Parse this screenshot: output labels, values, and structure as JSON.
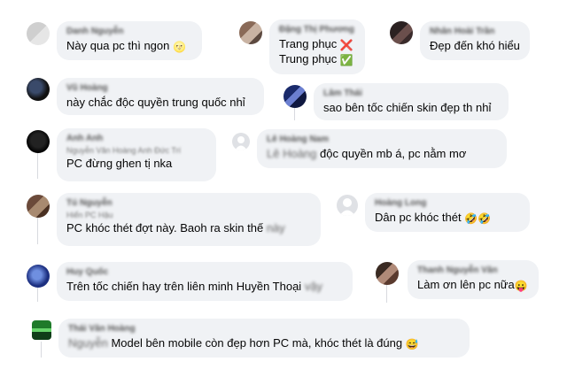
{
  "comments": [
    {
      "name": "Danh Nguyễn",
      "sub": "",
      "text": "Này qua pc thì ngon",
      "blur_suffix": "",
      "emoji": "🌝",
      "avatar": "grey-mosaic"
    },
    {
      "name": "Đặng Thị Phương",
      "sub": "",
      "lines": [
        "Trang phục",
        "Trung phục"
      ],
      "emojis": [
        "❌",
        "✅"
      ],
      "avatar": "photo-mosaic"
    },
    {
      "name": "Nhân Hoài Trần",
      "sub": "",
      "text": "Đẹp đến khó hiểu",
      "blur_suffix": "",
      "emoji": "",
      "avatar": "dark-mosaic"
    },
    {
      "name": "Vũ Hoàng",
      "sub": "",
      "text": "này chắc độc quyền trung quốc nhỉ",
      "blur_suffix": "",
      "emoji": "",
      "avatar": "dark-mosaic"
    },
    {
      "name": "Lâm Thái",
      "sub": "",
      "text": "sao bên tốc chiến skin đẹp th nhỉ",
      "blur_suffix": "",
      "emoji": "",
      "avatar": "blue-mosaic"
    },
    {
      "name": "Anh Anh",
      "sub": "Nguyễn Văn Hoàng Anh Đức Trí",
      "text": "PC đừng ghen tị nka",
      "blur_suffix": "",
      "emoji": "",
      "avatar": "black-mosaic"
    },
    {
      "name": "Lê Hoàng Nam",
      "sub": "Lê Hoàng",
      "text": "độc quyền mb á, pc nằm mơ",
      "blur_suffix": "",
      "emoji": "",
      "avatar": "default-avatar"
    },
    {
      "name": "Tú Nguyễn",
      "sub": "Hiển PC Hậu",
      "text": "PC khóc thét đợt này. Baoh ra skin thế",
      "blur_suffix": "này",
      "emoji": "",
      "avatar": "brown-mosaic"
    },
    {
      "name": "Hoàng Long",
      "sub": "",
      "text": "Dân pc khóc thét",
      "blur_suffix": "",
      "emoji": "🤣🤣",
      "avatar": "default-avatar"
    },
    {
      "name": "Huy Quốc",
      "sub": "",
      "text": "Trên tốc chiến hay trên liên minh Huyền Thoại",
      "blur_suffix": "vậy",
      "emoji": "",
      "avatar": "blue-mosaic"
    },
    {
      "name": "Thanh Nguyễn Văn",
      "sub": "",
      "text": "Làm ơn lên pc nữa",
      "blur_suffix": "",
      "emoji": "😛",
      "avatar": "brown-mosaic"
    },
    {
      "name": "Thái Văn Hoàng",
      "sub": "Nguyễn",
      "text": "Model bên mobile còn đẹp hơn PC mà, khóc thét là đúng",
      "blur_suffix": "",
      "emoji": "😅",
      "avatar": "green-mosaic"
    }
  ]
}
